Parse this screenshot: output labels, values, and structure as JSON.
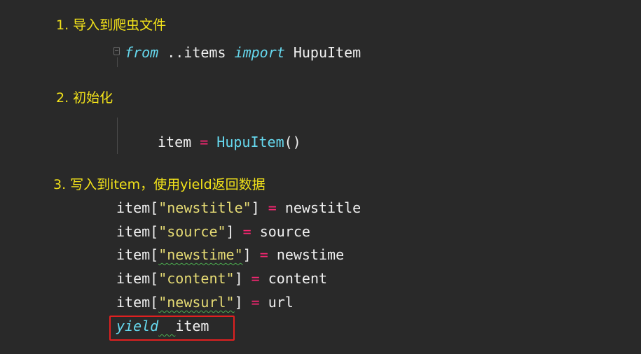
{
  "notes": {
    "step1": "1. 导入到爬虫文件",
    "step2": "2. 初始化",
    "step3": "3. 写入到item，使用yield返回数据"
  },
  "import_line": {
    "from_kw": "from",
    "module": " ..items ",
    "import_kw": "import",
    "name": " HupuItem"
  },
  "init_line": {
    "var": "item",
    "eq": " = ",
    "cls": "HupuItem",
    "parens": "()"
  },
  "assignments": [
    {
      "obj": "item",
      "lb": "[",
      "key": "\"newstitle\"",
      "rb": "]",
      "eq": " = ",
      "val": "newstitle"
    },
    {
      "obj": "item",
      "lb": "[",
      "key": "\"source\"",
      "rb": "]",
      "eq": " = ",
      "val": "source"
    },
    {
      "obj": "item",
      "lb": "[",
      "key": "\"newstime\"",
      "rb": "]",
      "eq": " = ",
      "val": "newstime"
    },
    {
      "obj": "item",
      "lb": "[",
      "key": "\"content\"",
      "rb": "]",
      "eq": " = ",
      "val": "content"
    },
    {
      "obj": "item",
      "lb": "[",
      "key": "\"newsurl\"",
      "rb": "]",
      "eq": " = ",
      "val": "url"
    }
  ],
  "yield_line": {
    "kw": "yield",
    "gap": "  ",
    "val": "item"
  },
  "colors": {
    "background": "#292929",
    "note": "#f2e21a",
    "keyword": "#66d9ef",
    "operator": "#f92672",
    "string": "#e6db74",
    "highlight_box": "#e02020"
  }
}
